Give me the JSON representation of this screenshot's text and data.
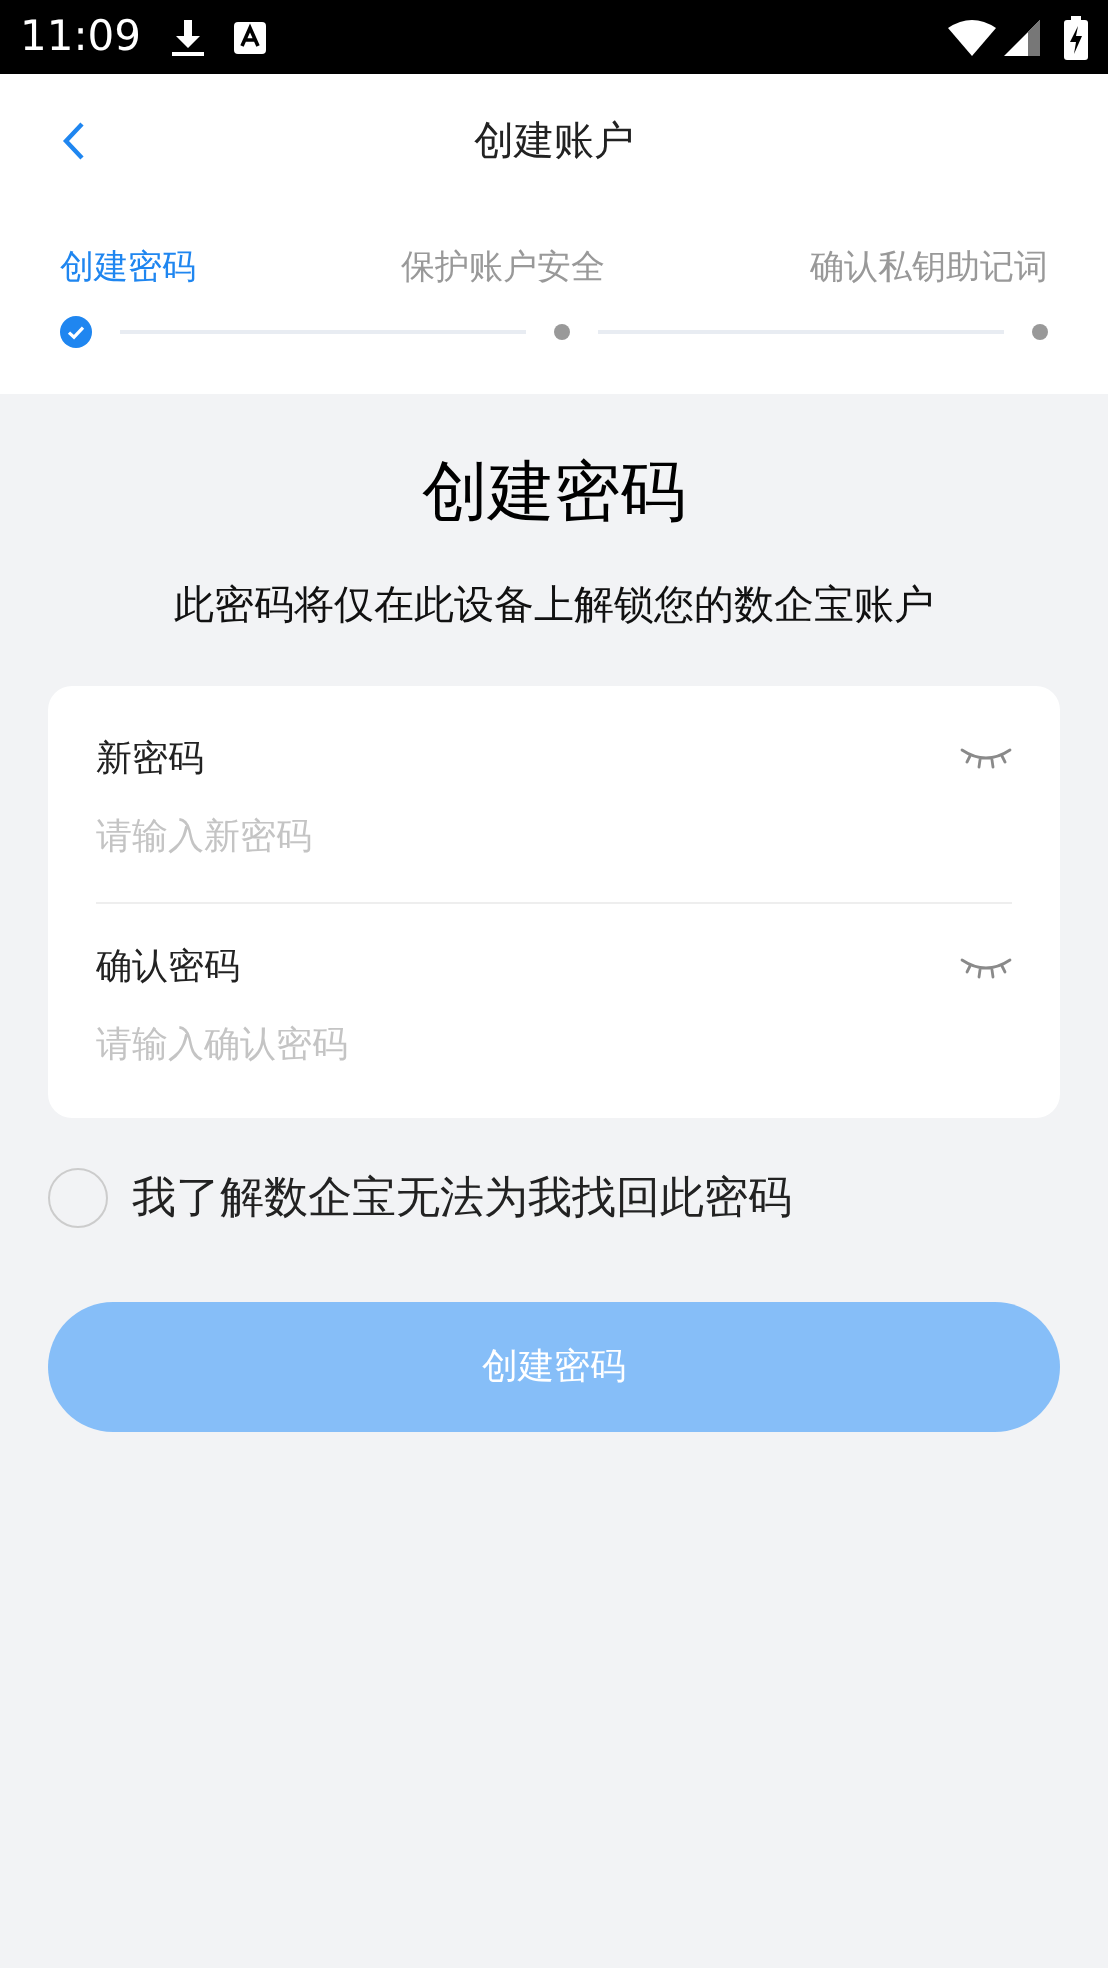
{
  "status_bar": {
    "time": "11:09"
  },
  "header": {
    "title": "创建账户"
  },
  "steps": [
    {
      "label": "创建密码",
      "selected": true,
      "done": true
    },
    {
      "label": "保护账户安全",
      "selected": false,
      "done": false
    },
    {
      "label": "确认私钥助记词",
      "selected": false,
      "done": false
    }
  ],
  "heading": "创建密码",
  "subtitle": "此密码将仅在此设备上解锁您的数企宝账户",
  "fields": [
    {
      "label": "新密码",
      "placeholder": "请输入新密码"
    },
    {
      "label": "确认密码",
      "placeholder": "请输入确认密码"
    }
  ],
  "agreement": {
    "label": "我了解数企宝无法为我找回此密码",
    "checked": false
  },
  "submit": {
    "label": "创建密码",
    "disabled": true
  }
}
